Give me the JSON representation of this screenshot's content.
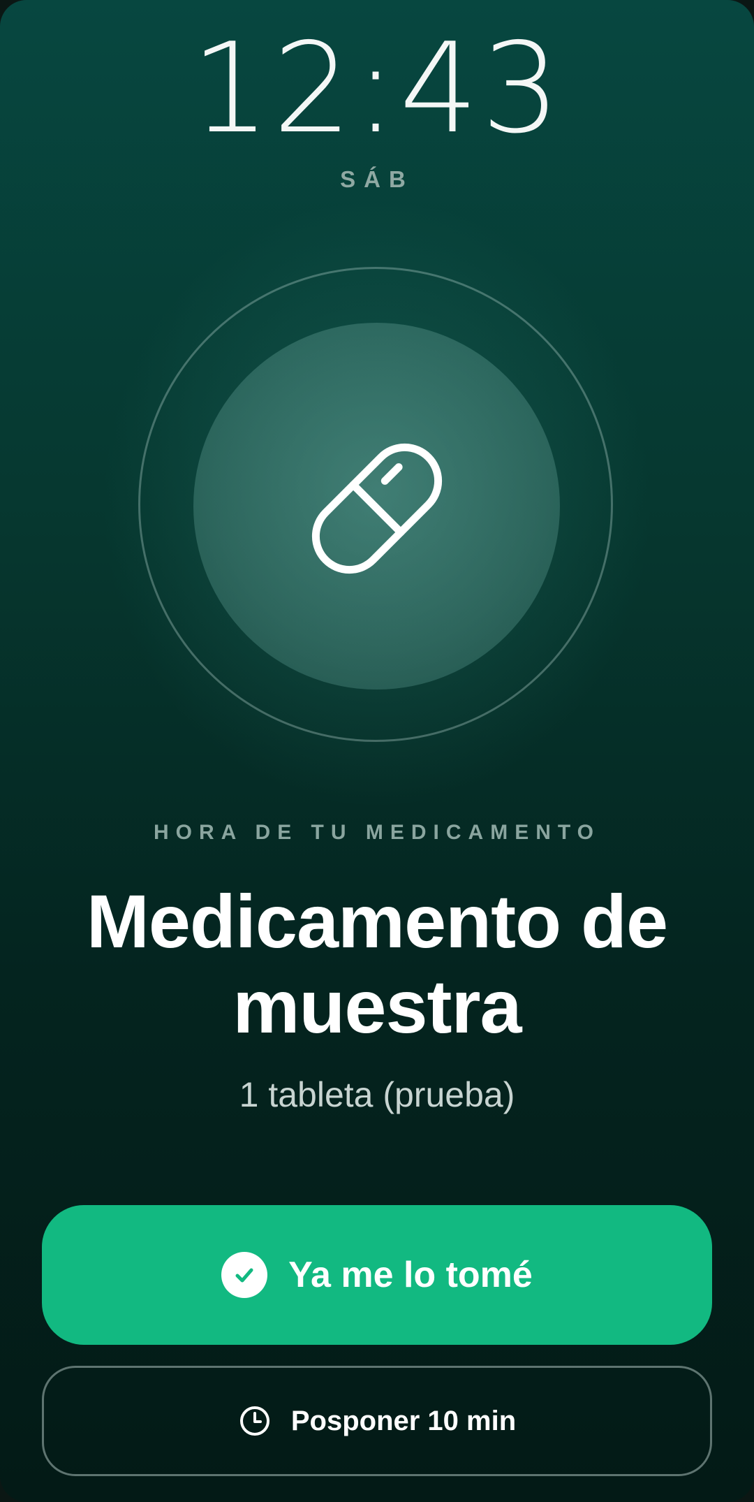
{
  "clock": {
    "time": "12:43",
    "day": "SÁB"
  },
  "reminder": {
    "eyebrow": "HORA DE TU MEDICAMENTO",
    "medication_name": "Medicamento de muestra",
    "dose": "1 tableta (prueba)",
    "icon": "pill-icon"
  },
  "actions": {
    "taken_label": "Ya me lo tomé",
    "taken_icon": "check-circle-icon",
    "snooze_label": "Posponer 10 min",
    "snooze_icon": "clock-icon"
  },
  "colors": {
    "background_top": "#074740",
    "background_bottom": "#031a16",
    "accent": "#12b981",
    "muted_text": "#8aa59f"
  }
}
